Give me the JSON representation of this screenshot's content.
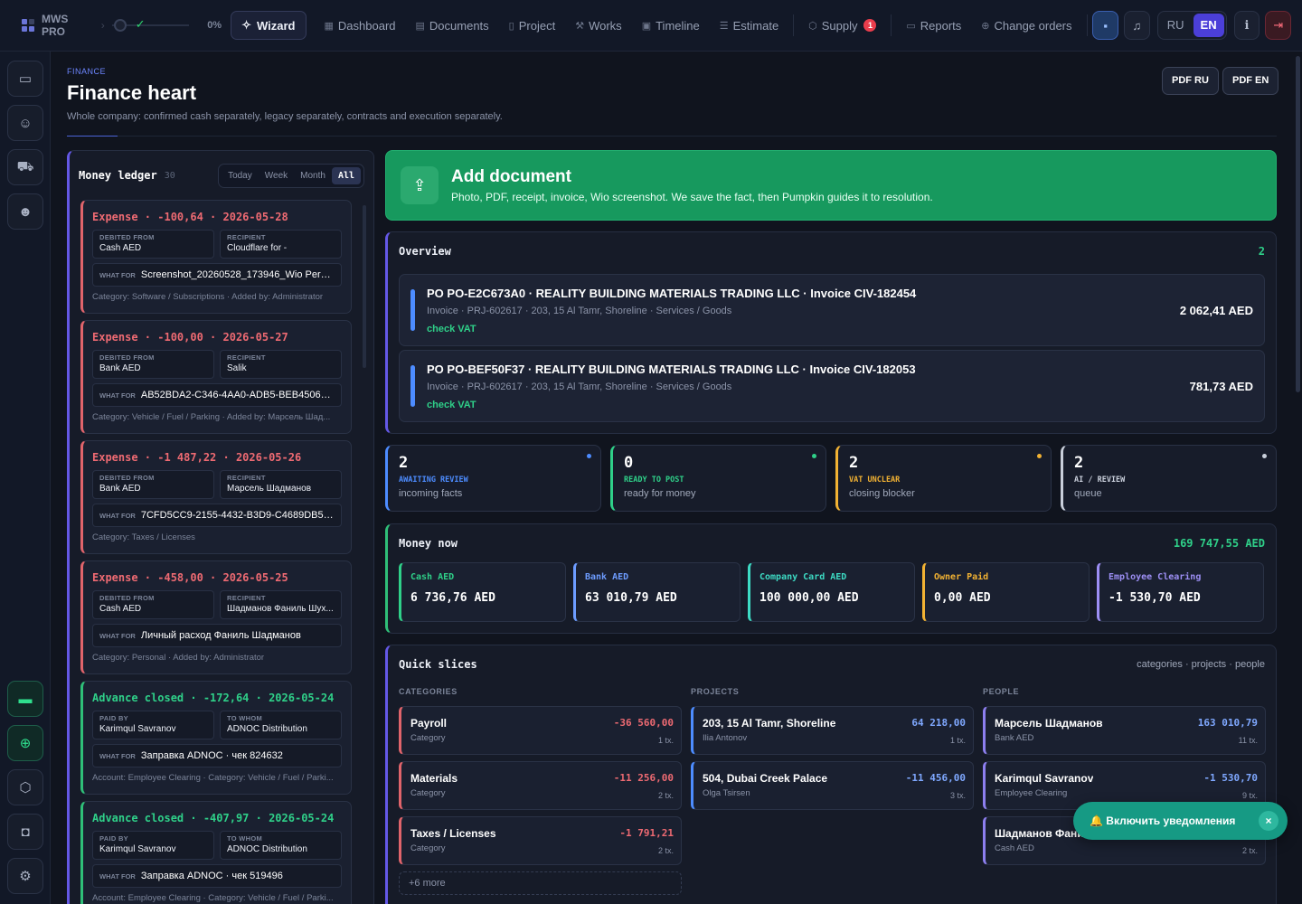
{
  "topbar": {
    "logo": "MWS PRO",
    "progress_pct": "0%",
    "progress_value": 0,
    "wizard": "Wizard",
    "nav": [
      "Dashboard",
      "Documents",
      "Project",
      "Works",
      "Timeline",
      "Estimate",
      "Supply",
      "Reports",
      "Change orders"
    ],
    "nav_icons": [
      "grid-icon",
      "document-icon",
      "file-icon",
      "wrench-icon",
      "calendar-icon",
      "list-icon",
      "box-icon",
      "report-icon",
      "plus-circle-icon"
    ],
    "supply_badge": "1",
    "lang_ru": "RU",
    "lang_en": "EN",
    "info": "i"
  },
  "header": {
    "eyebrow": "FINANCE",
    "title": "Finance heart",
    "subtitle": "Whole company: confirmed cash separately, legacy separately, contracts and execution separately.",
    "pdf_ru": "PDF RU",
    "pdf_en": "PDF EN"
  },
  "ledger": {
    "title": "Money ledger",
    "count": "30",
    "filters": [
      "Today",
      "Week",
      "Month",
      "All"
    ],
    "active_filter": "All",
    "entries": [
      {
        "kind": "expense",
        "head": "Expense · -100,64 · 2026-05-28",
        "l1": "DEBITED FROM",
        "v1": "Cash AED",
        "l2": "RECIPIENT",
        "v2": "Cloudflare for -",
        "what": "Screenshot_20260528_173946_Wio Perso...",
        "meta": "Category: Software / Subscriptions · Added by: Administrator"
      },
      {
        "kind": "expense",
        "head": "Expense · -100,00 · 2026-05-27",
        "l1": "DEBITED FROM",
        "v1": "Bank AED",
        "l2": "RECIPIENT",
        "v2": "Salik",
        "what": "AB52BDA2-C346-4AA0-ADB5-BEB4506A...",
        "meta": "Category: Vehicle / Fuel / Parking · Added by: Марсель Шад..."
      },
      {
        "kind": "expense",
        "head": "Expense · -1 487,22 · 2026-05-26",
        "l1": "DEBITED FROM",
        "v1": "Bank AED",
        "l2": "RECIPIENT",
        "v2": "Марсель Шадманов",
        "what": "7CFD5CC9-2155-4432-B3D9-C4689DB58...",
        "meta": "Category: Taxes / Licenses"
      },
      {
        "kind": "expense",
        "head": "Expense · -458,00 · 2026-05-25",
        "l1": "DEBITED FROM",
        "v1": "Cash AED",
        "l2": "RECIPIENT",
        "v2": "Шадманов Фаниль Шух...",
        "what": "Личный расход Фаниль Шадманов",
        "meta": "Category: Personal · Added by: Administrator"
      },
      {
        "kind": "advance",
        "head": "Advance closed · -172,64 · 2026-05-24",
        "l1": "PAID BY",
        "v1": "Karimqul Savranov",
        "l2": "TO WHOM",
        "v2": "ADNOC Distribution",
        "what": "Заправка ADNOC · чек 824632",
        "meta": "Account: Employee Clearing · Category: Vehicle / Fuel / Parki..."
      },
      {
        "kind": "advance",
        "head": "Advance closed · -407,97 · 2026-05-24",
        "l1": "PAID BY",
        "v1": "Karimqul Savranov",
        "l2": "TO WHOM",
        "v2": "ADNOC Distribution",
        "what": "Заправка ADNOC · чек 519496",
        "meta": "Account: Employee Clearing · Category: Vehicle / Fuel / Parki..."
      }
    ],
    "what_label": "WHAT FOR"
  },
  "add_document": {
    "title": "Add document",
    "subtitle": "Photo, PDF, receipt, invoice, Wio screenshot. We save the fact, then Pumpkin guides it to resolution."
  },
  "overview": {
    "title": "Overview",
    "count": "2",
    "items": [
      {
        "title": "PO PO-E2C673A0 · REALITY BUILDING MATERIALS TRADING LLC · Invoice CIV-182454",
        "sub": "Invoice · PRJ-602617 · 203, 15 Al Tamr, Shoreline · Services / Goods",
        "flag": "check VAT",
        "amount": "2 062,41 AED"
      },
      {
        "title": "PO PO-BEF50F37 · REALITY BUILDING MATERIALS TRADING LLC · Invoice CIV-182053",
        "sub": "Invoice · PRJ-602617 · 203, 15 Al Tamr, Shoreline · Services / Goods",
        "flag": "check VAT",
        "amount": "781,73 AED"
      }
    ]
  },
  "stats": [
    {
      "n": "2",
      "label": "AWAITING REVIEW",
      "desc": "incoming facts",
      "color": "#4d8cff"
    },
    {
      "n": "0",
      "label": "READY TO POST",
      "desc": "ready for money",
      "color": "#2fd089"
    },
    {
      "n": "2",
      "label": "VAT UNCLEAR",
      "desc": "closing blocker",
      "color": "#f2b233"
    },
    {
      "n": "2",
      "label": "AI / REVIEW",
      "desc": "queue",
      "color": "#c9cfdb"
    }
  ],
  "money_now": {
    "title": "Money now",
    "total": "169 747,55 AED",
    "accounts": [
      {
        "label": "Cash AED",
        "value": "6 736,76 AED",
        "color": "#2fd089"
      },
      {
        "label": "Bank AED",
        "value": "63 010,79 AED",
        "color": "#6d9cff"
      },
      {
        "label": "Company Card AED",
        "value": "100 000,00 AED",
        "color": "#3ddbc4"
      },
      {
        "label": "Owner Paid",
        "value": "0,00 AED",
        "color": "#f2b233"
      },
      {
        "label": "Employee Clearing",
        "value": "-1 530,70 AED",
        "color": "#9d8ff5"
      }
    ]
  },
  "quick_slices": {
    "title": "Quick slices",
    "hint": "categories · projects · people",
    "col_categories": "CATEGORIES",
    "col_projects": "PROJECTS",
    "col_people": "PEOPLE",
    "categories": [
      {
        "t": "Payroll",
        "s": "Category",
        "v": "-36 560,00",
        "c": "1 tx."
      },
      {
        "t": "Materials",
        "s": "Category",
        "v": "-11 256,00",
        "c": "2 tx."
      },
      {
        "t": "Taxes / Licenses",
        "s": "Category",
        "v": "-1 791,21",
        "c": "2 tx."
      }
    ],
    "projects": [
      {
        "t": "203, 15 Al Tamr, Shoreline",
        "s": "Ilia Antonov",
        "v": "64 218,00",
        "c": "1 tx."
      },
      {
        "t": "504, Dubai Creek Palace",
        "s": "Olga Tsirsen",
        "v": "-11 456,00",
        "c": "3 tx."
      }
    ],
    "people": [
      {
        "t": "Марсель Шадманов",
        "s": "Bank AED",
        "v": "163 010,79",
        "c": "11 tx."
      },
      {
        "t": "Karimqul Savranov",
        "s": "Employee Clearing",
        "v": "-1 530,70",
        "c": "9 tx."
      },
      {
        "t": "Шадманов Фаниль",
        "s": "Cash AED",
        "v": "",
        "c": "2 tx."
      }
    ],
    "more": "+6 more"
  },
  "toast": {
    "text": "🔔 Включить уведомления",
    "close": "×"
  }
}
